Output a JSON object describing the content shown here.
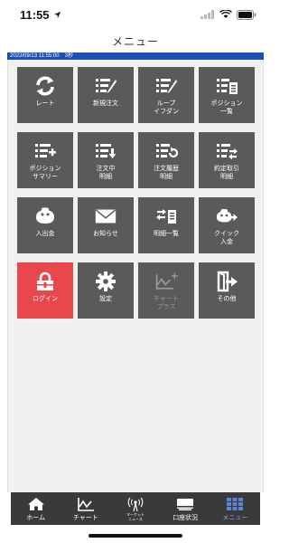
{
  "status_bar": {
    "time": "11:55"
  },
  "header": {
    "title": "メニュー"
  },
  "info_bar": {
    "text": "2022/09/13 11:55:00　3秒"
  },
  "menu": {
    "tiles": [
      {
        "label": "レート",
        "icon": "refresh-icon"
      },
      {
        "label": "新規注文",
        "icon": "new-order-icon"
      },
      {
        "label": "ループ\nイフダン",
        "icon": "loop-ifdone-icon"
      },
      {
        "label": "ポジション\n一覧",
        "icon": "position-list-icon"
      },
      {
        "label": "ポジション\nサマリー",
        "icon": "position-summary-icon"
      },
      {
        "label": "注文中\n明細",
        "icon": "pending-orders-icon"
      },
      {
        "label": "注文履歴\n明細",
        "icon": "order-history-icon"
      },
      {
        "label": "約定取引\n明細",
        "icon": "executed-trades-icon"
      },
      {
        "label": "入出金",
        "icon": "wallet-icon"
      },
      {
        "label": "お知らせ",
        "icon": "envelope-icon"
      },
      {
        "label": "明細一覧",
        "icon": "statements-icon"
      },
      {
        "label": "クイック\n入金",
        "icon": "quick-deposit-icon"
      },
      {
        "label": "ログイン",
        "icon": "lock-icon"
      },
      {
        "label": "設定",
        "icon": "gear-icon"
      },
      {
        "label": "チャート\nプラス",
        "icon": "chart-plus-icon"
      },
      {
        "label": "その他",
        "icon": "exit-icon"
      }
    ]
  },
  "tabbar": {
    "tabs": [
      {
        "label": "ホーム",
        "icon": "home-icon"
      },
      {
        "label": "チャート",
        "icon": "chart-icon"
      },
      {
        "label": "マーケット\nニュース",
        "icon": "antenna-icon"
      },
      {
        "label": "口座状況",
        "icon": "account-icon"
      },
      {
        "label": "メニュー",
        "icon": "grid-menu-icon"
      }
    ]
  },
  "colors": {
    "tile": "#5a5a5a",
    "tile_login": "#e8474b",
    "info_bar": "#1b4fb4",
    "tabbar": "#3a3a3a",
    "active_tab": "#8aa7e0"
  }
}
